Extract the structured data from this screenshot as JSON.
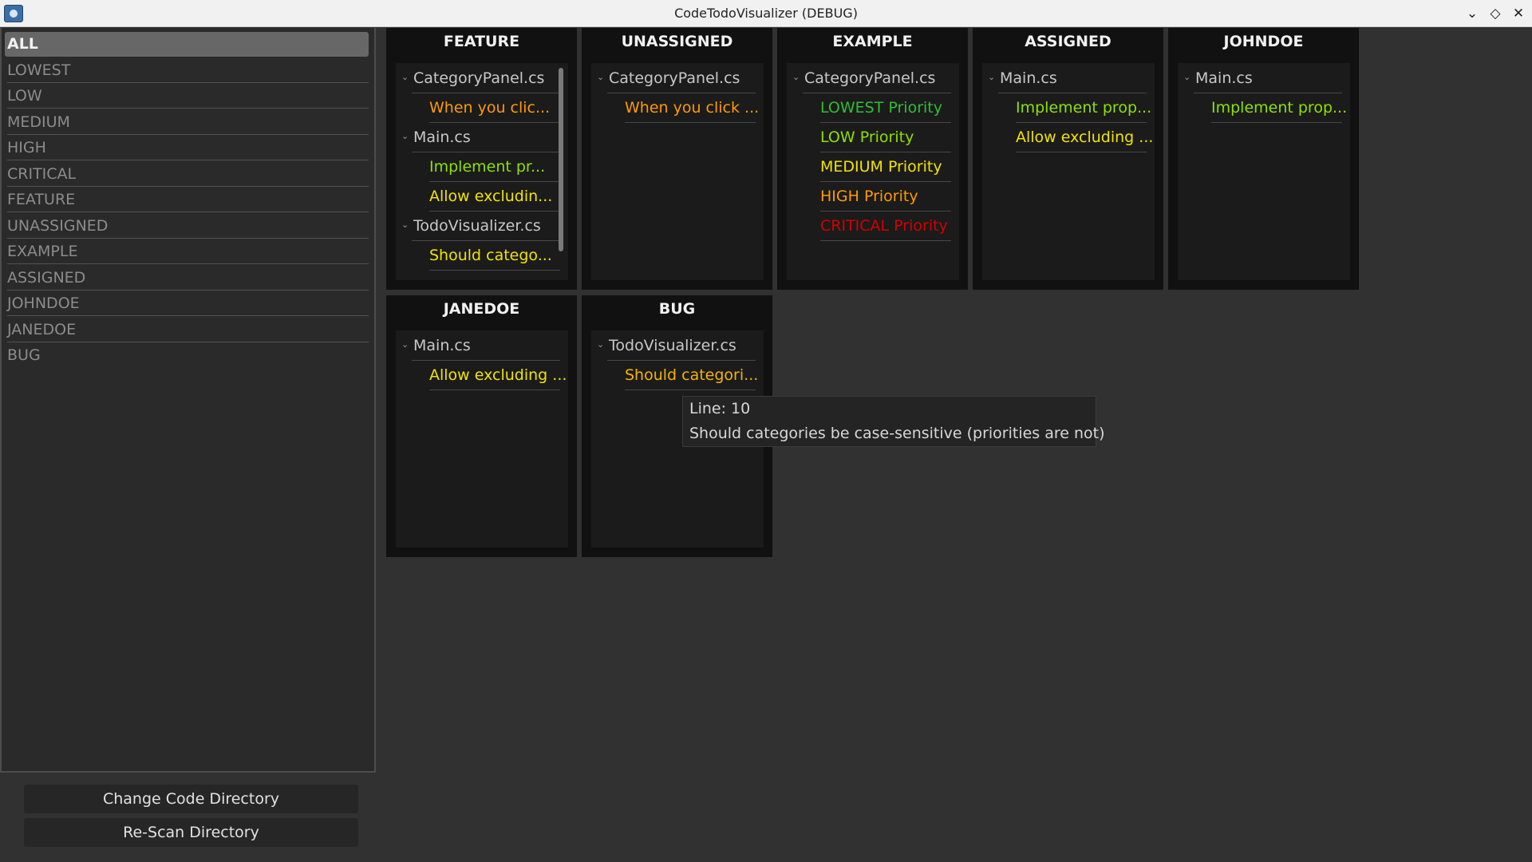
{
  "window": {
    "title": "CodeTodoVisualizer (DEBUG)"
  },
  "sidebar": {
    "items": [
      {
        "label": "ALL",
        "selected": true
      },
      {
        "label": "LOWEST"
      },
      {
        "label": "LOW"
      },
      {
        "label": "MEDIUM"
      },
      {
        "label": "HIGH"
      },
      {
        "label": "CRITICAL"
      },
      {
        "label": "FEATURE"
      },
      {
        "label": "UNASSIGNED"
      },
      {
        "label": "EXAMPLE"
      },
      {
        "label": "ASSIGNED"
      },
      {
        "label": "JOHNDOE"
      },
      {
        "label": "JANEDOE"
      },
      {
        "label": "BUG"
      }
    ]
  },
  "buttons": {
    "change_dir": "Change Code Directory",
    "rescan": "Re-Scan Directory"
  },
  "colors": {
    "lowest": "#2fbf2f",
    "low": "#8ee000",
    "medium": "#f0e400",
    "high": "#ff9a00",
    "critical": "#d20000",
    "amber": "#f5b300"
  },
  "panels": [
    {
      "title": "FEATURE",
      "groups": [
        {
          "file": "CategoryPanel.cs",
          "todos": [
            {
              "text": "When you clic...",
              "priority": "high"
            }
          ]
        },
        {
          "file": "Main.cs",
          "todos": [
            {
              "text": "Implement pr...",
              "priority": "low"
            },
            {
              "text": "Allow excludin...",
              "priority": "medium"
            }
          ]
        },
        {
          "file": "TodoVisualizer.cs",
          "todos": [
            {
              "text": "Should catego...",
              "priority": "medium"
            }
          ]
        }
      ],
      "has_scrollbar": true
    },
    {
      "title": "UNASSIGNED",
      "groups": [
        {
          "file": "CategoryPanel.cs",
          "todos": [
            {
              "text": "When you click ...",
              "priority": "high"
            }
          ]
        }
      ]
    },
    {
      "title": "EXAMPLE",
      "groups": [
        {
          "file": "CategoryPanel.cs",
          "todos": [
            {
              "text": "LOWEST Priority",
              "priority": "lowest"
            },
            {
              "text": "LOW Priority",
              "priority": "low"
            },
            {
              "text": "MEDIUM Priority",
              "priority": "medium"
            },
            {
              "text": "HIGH Priority",
              "priority": "high"
            },
            {
              "text": "CRITICAL Priority",
              "priority": "critical"
            }
          ]
        }
      ]
    },
    {
      "title": "ASSIGNED",
      "groups": [
        {
          "file": "Main.cs",
          "todos": [
            {
              "text": "Implement prop...",
              "priority": "low"
            },
            {
              "text": "Allow excluding ...",
              "priority": "medium"
            }
          ]
        }
      ]
    },
    {
      "title": "JOHNDOE",
      "groups": [
        {
          "file": "Main.cs",
          "todos": [
            {
              "text": "Implement prop...",
              "priority": "low"
            }
          ]
        }
      ]
    },
    {
      "title": "JANEDOE",
      "groups": [
        {
          "file": "Main.cs",
          "todos": [
            {
              "text": "Allow excluding ...",
              "priority": "medium"
            }
          ]
        }
      ]
    },
    {
      "title": "BUG",
      "groups": [
        {
          "file": "TodoVisualizer.cs",
          "todos": [
            {
              "text": "Should categori...",
              "priority": "medium"
            }
          ]
        }
      ]
    }
  ],
  "tooltip": {
    "line": "Line: 10",
    "text": "Should categories be case-sensitive (priorities are not)"
  }
}
